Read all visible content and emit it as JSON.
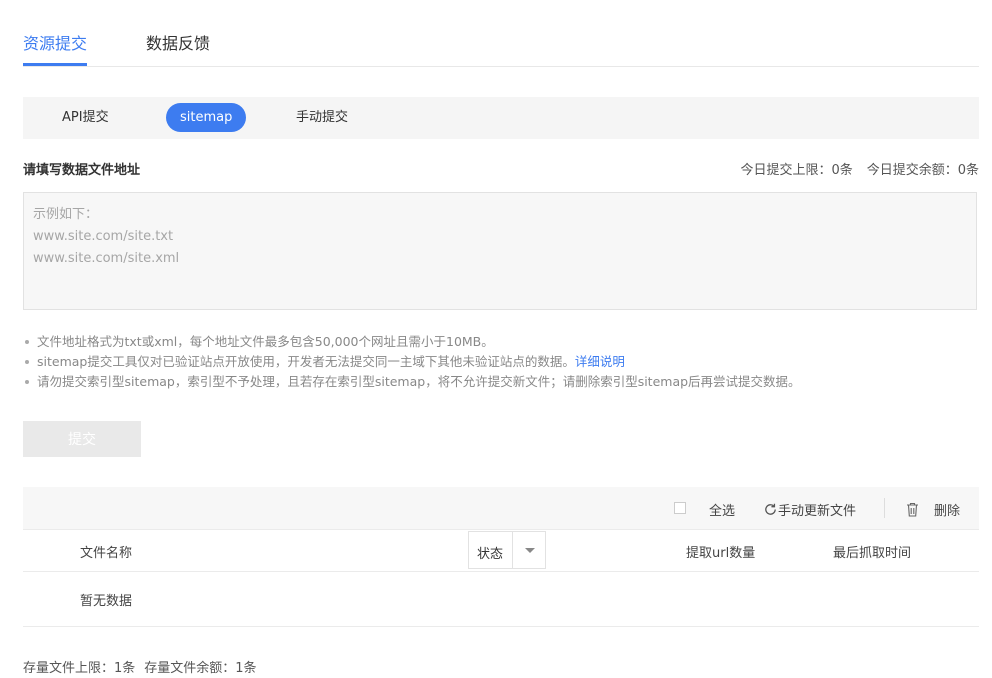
{
  "tabs": [
    "资源提交",
    "数据反馈"
  ],
  "subtabs": [
    "API提交",
    "sitemap",
    "手动提交"
  ],
  "form": {
    "label": "请填写数据文件地址",
    "limit_today": "今日提交上限：0条",
    "remain_today": "今日提交余额：0条",
    "placeholder": "示例如下：\nwww.site.com/site.txt\nwww.site.com/site.xml"
  },
  "notes": {
    "n1": "文件地址格式为txt或xml，每个地址文件最多包含50,000个网址且需小于10MB。",
    "n2": "sitemap提交工具仅对已验证站点开放使用，开发者无法提交同一主域下其他未验证站点的数据。",
    "n2_link": "详细说明",
    "n3": "请勿提交索引型sitemap，索引型不予处理，且若存在索引型sitemap，将不允许提交新文件；请删除索引型sitemap后再尝试提交数据。"
  },
  "submit_label": "提交",
  "toolbar": {
    "select_all": "全选",
    "refresh": "手动更新文件",
    "delete": "删除"
  },
  "table": {
    "col_name": "文件名称",
    "col_status": "状态",
    "col_count": "提取url数量",
    "col_time": "最后抓取时间",
    "empty": "暂无数据"
  },
  "footer": {
    "limit": "存量文件上限：1条",
    "remain": "存量文件余额：1条"
  },
  "colors": {
    "accent": "#3d7cf0"
  },
  "icons": [
    "refresh-icon",
    "trash-icon",
    "caret-down-icon"
  ]
}
